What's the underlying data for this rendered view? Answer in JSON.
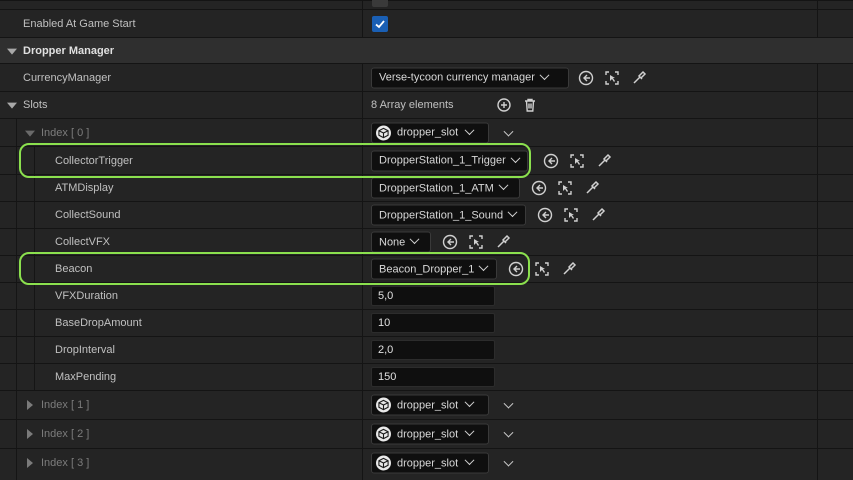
{
  "rows": {
    "enabled": {
      "label": "Enabled At Game Start",
      "checked": true
    },
    "category": {
      "label": "Dropper Manager"
    },
    "currency": {
      "label": "CurrencyManager",
      "value": "Verse-tycoon currency manager"
    },
    "slots": {
      "label": "Slots",
      "count": "8 Array elements"
    },
    "index0": {
      "label": "Index [ 0 ]",
      "value": "dropper_slot"
    },
    "collector": {
      "label": "CollectorTrigger",
      "value": "DropperStation_1_Trigger"
    },
    "atm": {
      "label": "ATMDisplay",
      "value": "DropperStation_1_ATM"
    },
    "sound": {
      "label": "CollectSound",
      "value": "DropperStation_1_Sound"
    },
    "vfx": {
      "label": "CollectVFX",
      "value": "None"
    },
    "beacon": {
      "label": "Beacon",
      "value": "Beacon_Dropper_1"
    },
    "vfxdur": {
      "label": "VFXDuration",
      "value": "5,0"
    },
    "basedrop": {
      "label": "BaseDropAmount",
      "value": "10"
    },
    "interval": {
      "label": "DropInterval",
      "value": "2,0"
    },
    "maxpending": {
      "label": "MaxPending",
      "value": "150"
    },
    "index1": {
      "label": "Index [ 1 ]",
      "value": "dropper_slot"
    },
    "index2": {
      "label": "Index [ 2 ]",
      "value": "dropper_slot"
    },
    "index3": {
      "label": "Index [ 3 ]",
      "value": "dropper_slot"
    }
  },
  "colors": {
    "highlight": "#8be04e",
    "checkbox": "#1a5fb4"
  },
  "icons": [
    "browse-back-icon",
    "select-actor-icon",
    "eyedropper-icon",
    "add-element-icon",
    "trash-icon",
    "cube-icon"
  ]
}
